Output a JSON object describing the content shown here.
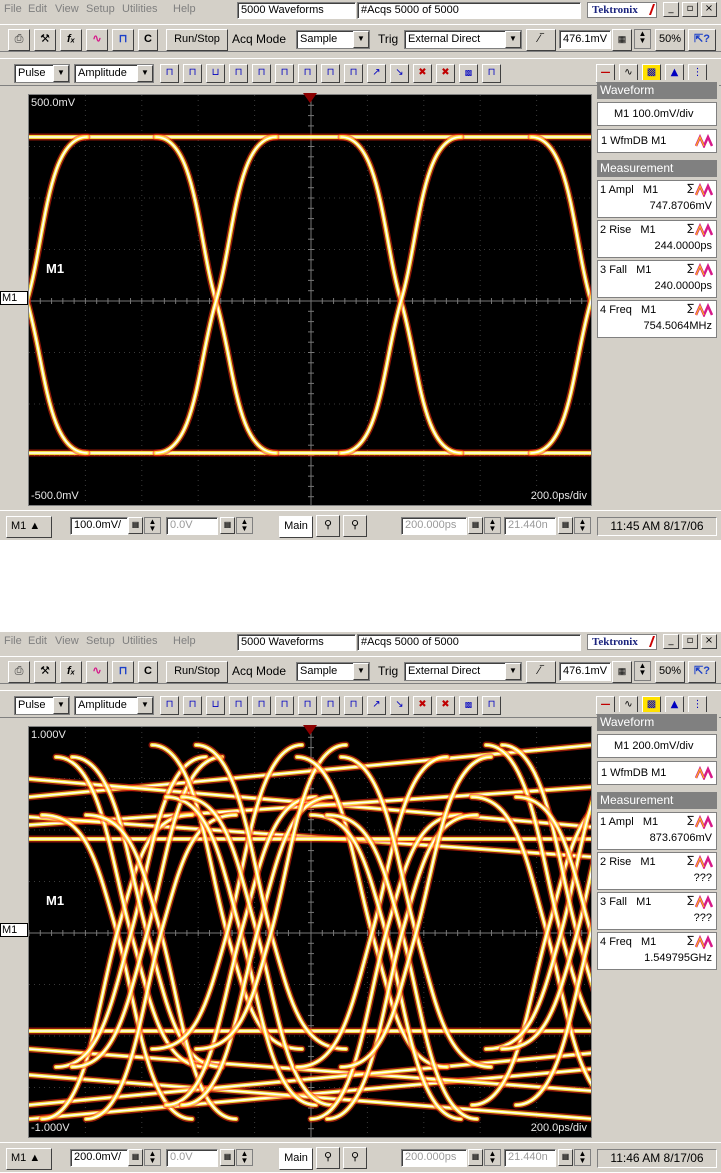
{
  "menu": [
    "File",
    "Edit",
    "View",
    "Setup",
    "Utilities",
    "Help"
  ],
  "brand": "Tektronix",
  "window_buttons": [
    "_",
    "̂",
    "x"
  ],
  "toolbar": {
    "icons": [
      "print-icon",
      "tools-icon",
      "fx-icon",
      "waveform-icon",
      "autoset-icon"
    ],
    "c_label": "C",
    "runstop_label": "Run/Stop",
    "acqmode_label": "Acq Mode",
    "acqmode_value": "Sample",
    "trig_label": "Trig",
    "trig_value": "External Direct",
    "trig_level": "476.1mV",
    "zoom_label": "50%",
    "measure_group": "Pulse",
    "measure_type": "Amplitude",
    "icon_strip": [
      "JL",
      "JL",
      "JL",
      "JL",
      "JL",
      "JL",
      "JL",
      "JL",
      "JL",
      "JL",
      "JL",
      "JL",
      "JL",
      "JL"
    ]
  },
  "screens": [
    {
      "title_field": "5000 Waveforms",
      "acqs_field": "#Acqs  5000 of 5000",
      "top_volt": "500.0mV",
      "bottom_volt": "-500.0mV",
      "timebase": "200.0ps/div",
      "channel_label": "M1",
      "ground_marker": "M1",
      "waveform_info": "M1 100.0mV/div",
      "wfm_db": "1 WfmDB M1",
      "bottom": {
        "channel": "M1",
        "scale": "100.0mV/",
        "offset": "0.0V",
        "timeline": "Main",
        "delay": "200.000ps",
        "pos": "21.440n",
        "clock": "11:45 AM 8/17/06"
      },
      "measurements": [
        {
          "n": "1",
          "name": "Ampl",
          "src": "M1",
          "value": "747.8706mV"
        },
        {
          "n": "2",
          "name": "Rise",
          "src": "M1",
          "value": "244.0000ps"
        },
        {
          "n": "3",
          "name": "Fall",
          "src": "M1",
          "value": "240.0000ps"
        },
        {
          "n": "4",
          "name": "Freq",
          "src": "M1",
          "value": "754.5064MHz"
        }
      ],
      "eye": "clean"
    },
    {
      "title_field": "5000 Waveforms",
      "acqs_field": "#Acqs  5000 of 5000",
      "top_volt": "1.000V",
      "bottom_volt": "-1.000V",
      "timebase": "200.0ps/div",
      "channel_label": "M1",
      "ground_marker": "M1",
      "waveform_info": "M1 200.0mV/div",
      "wfm_db": "1 WfmDB M1",
      "bottom": {
        "channel": "M1",
        "scale": "200.0mV/",
        "offset": "0.0V",
        "timeline": "Main",
        "delay": "200.000ps",
        "pos": "21.440n",
        "clock": "11:46 AM 8/17/06"
      },
      "measurements": [
        {
          "n": "1",
          "name": "Ampl",
          "src": "M1",
          "value": "873.6706mV"
        },
        {
          "n": "2",
          "name": "Rise",
          "src": "M1",
          "value": "???"
        },
        {
          "n": "3",
          "name": "Fall",
          "src": "M1",
          "value": "???"
        },
        {
          "n": "4",
          "name": "Freq",
          "src": "M1",
          "value": "1.549795GHz"
        }
      ],
      "eye": "jittery"
    }
  ],
  "panel": {
    "waveform_head": "Waveform",
    "measurement_head": "Measurement"
  },
  "colors": {
    "trace_core": "#ffffff",
    "trace_mid": "#ffee44",
    "trace_outer": "#ff2a10",
    "screen_bg": "#000000",
    "panel_head": "#808080"
  }
}
